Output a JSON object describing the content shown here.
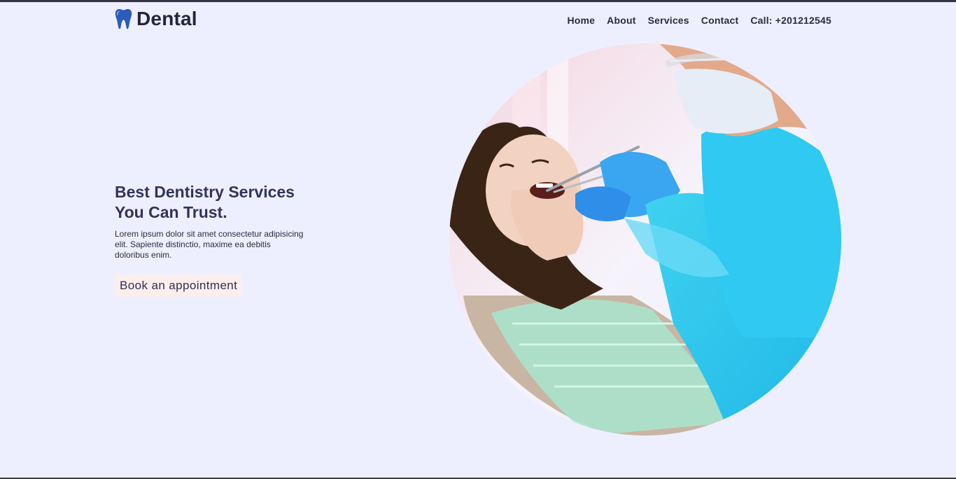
{
  "brand": {
    "name": "Dental",
    "icon": "tooth-icon",
    "accent": "#2b5cb8"
  },
  "nav": {
    "items": [
      "Home",
      "About",
      "Services",
      "Contact",
      "Call: +201212545"
    ]
  },
  "hero": {
    "title_line1": "Best Dentistry Services",
    "title_line2": "You Can Trust.",
    "description": "Lorem ipsum dolor sit amet consectetur adipisicing elit. Sapiente distinctio, maxime ea debitis doloribus enim.",
    "cta_label": "Book an appointment",
    "cta_color": "#fbeeed",
    "title_color": "#30345a"
  },
  "colors": {
    "background": "#eeeffe"
  }
}
